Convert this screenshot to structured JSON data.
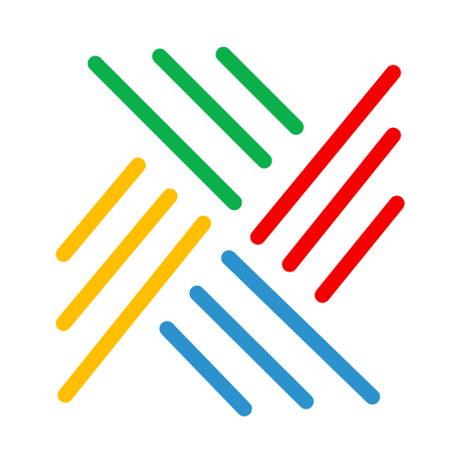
{
  "logo": {
    "icon": "woven-stripes-x-logo",
    "background": "#ffffff",
    "groups": [
      {
        "name": "green",
        "color": "#0BB04A",
        "stripe_count": 3
      },
      {
        "name": "red",
        "color": "#F50000",
        "stripe_count": 3
      },
      {
        "name": "yellow",
        "color": "#FFBE00",
        "stripe_count": 3
      },
      {
        "name": "blue",
        "color": "#2B92CE",
        "stripe_count": 3
      }
    ]
  }
}
